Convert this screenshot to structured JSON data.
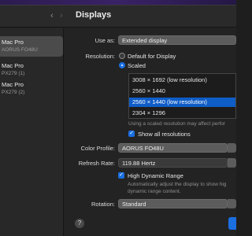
{
  "window": {
    "title": "Displays"
  },
  "nav": {
    "back_glyph": "‹",
    "forward_glyph": "›"
  },
  "sidebar": {
    "monitors": [
      {
        "name": "Mac Pro",
        "sub": "AORUS FO48U"
      },
      {
        "name": "Mac Pro",
        "sub": "PX279 (1)"
      },
      {
        "name": "Mac Pro",
        "sub": "PX279 (2)"
      }
    ]
  },
  "use_as": {
    "label": "Use as:",
    "value": "Extended display"
  },
  "resolution": {
    "label": "Resolution:",
    "options": [
      {
        "label": "Default for Display",
        "selected": false
      },
      {
        "label": "Scaled",
        "selected": true
      }
    ],
    "list": [
      "3008 × 1692 (low resolution)",
      "2560 × 1440",
      "2560 × 1440 (low resolution)",
      "2304 × 1296"
    ],
    "selected_index": 2,
    "note": "Using a scaled resolution may affect perfor",
    "show_all_label": "Show all resolutions"
  },
  "color_profile": {
    "label": "Color Profile:",
    "value": "AORUS FO48U"
  },
  "refresh_rate": {
    "label": "Refresh Rate:",
    "value": "119.88 Hertz"
  },
  "hdr": {
    "label": "High Dynamic Range",
    "note_line1": "Automatically adjust the display to show hig",
    "note_line2": "dynamic range content."
  },
  "rotation": {
    "label": "Rotation:",
    "value": "Standard"
  },
  "help": {
    "glyph": "?"
  },
  "colors": {
    "accent": "#1a6ee0",
    "selection": "#0f5dc7"
  }
}
